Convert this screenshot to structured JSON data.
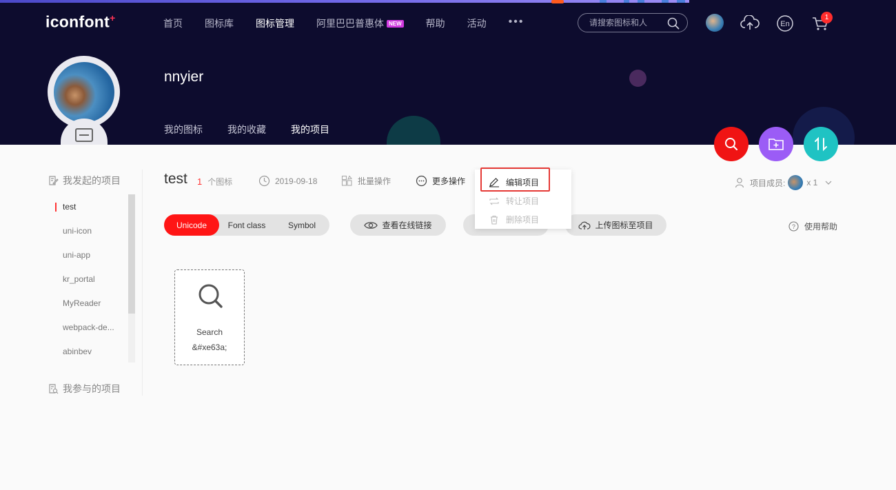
{
  "header": {
    "logo": "iconfont",
    "nav": [
      {
        "label": "首页"
      },
      {
        "label": "图标库"
      },
      {
        "label": "图标管理"
      },
      {
        "label": "阿里巴巴普惠体"
      },
      {
        "label": "帮助"
      },
      {
        "label": "活动"
      }
    ],
    "new_badge": "NEW",
    "more": "•••",
    "search_placeholder": "请搜索图标和人",
    "lang_label": "En",
    "cart_count": "1"
  },
  "profile": {
    "username": "nnyier",
    "tabs": [
      {
        "label": "我的图标"
      },
      {
        "label": "我的收藏"
      },
      {
        "label": "我的项目"
      }
    ]
  },
  "sidebar": {
    "my_projects_title": "我发起的项目",
    "projects": [
      "test",
      "uni-icon",
      "uni-app",
      "kr_portal",
      "MyReader",
      "webpack-de...",
      "abinbev"
    ],
    "joined_title": "我参与的项目"
  },
  "project": {
    "name": "test",
    "icon_count": "1",
    "icon_count_unit": "个图标",
    "date": "2019-09-18",
    "batch_label": "批量操作",
    "more_label": "更多操作",
    "members_label": "项目成员:",
    "members_count": "x 1"
  },
  "dropdown": {
    "items": [
      {
        "label": "编辑项目"
      },
      {
        "label": "转让项目"
      },
      {
        "label": "删除项目"
      }
    ]
  },
  "toolbar": {
    "segments": [
      "Unicode",
      "Font class",
      "Symbol"
    ],
    "view_link": "查看在线链接",
    "upload": "上传图标至项目",
    "help": "使用帮助"
  },
  "icons": [
    {
      "name": "Search",
      "code": "&#xe63a;"
    }
  ],
  "colors": {
    "header_bg": "#0d0c2e",
    "accent_red": "#ff1515",
    "fab_search": "#f01414",
    "fab_folder": "#9b5cf6",
    "fab_sort": "#1fc3c3"
  }
}
